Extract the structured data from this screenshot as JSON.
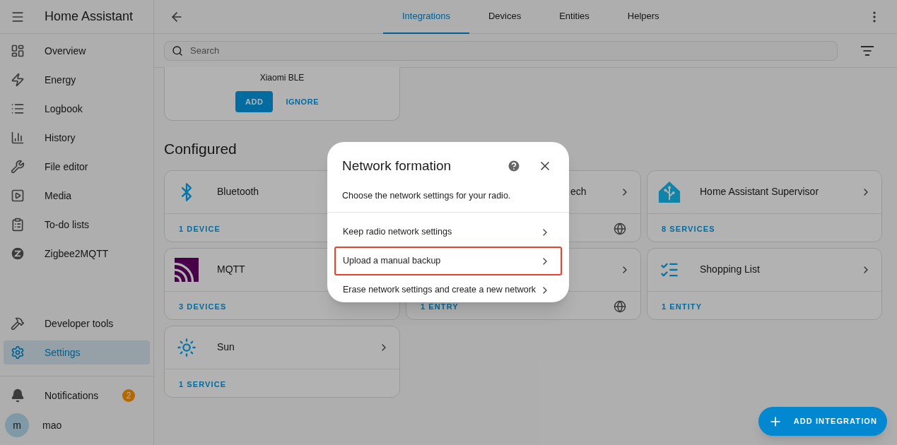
{
  "sidebar": {
    "title": "Home Assistant",
    "items": [
      {
        "label": "Overview",
        "selected": false
      },
      {
        "label": "Energy",
        "selected": false
      },
      {
        "label": "Logbook",
        "selected": false
      },
      {
        "label": "History",
        "selected": false
      },
      {
        "label": "File editor",
        "selected": false
      },
      {
        "label": "Media",
        "selected": false
      },
      {
        "label": "To-do lists",
        "selected": false
      },
      {
        "label": "Zigbee2MQTT",
        "selected": false
      }
    ],
    "bottom_items": [
      {
        "label": "Developer tools",
        "selected": false
      },
      {
        "label": "Settings",
        "selected": true
      }
    ],
    "notifications": {
      "label": "Notifications",
      "badge": "2"
    },
    "user": {
      "initial": "m",
      "name": "mao"
    }
  },
  "tabs": [
    {
      "label": "Integrations",
      "selected": true
    },
    {
      "label": "Devices",
      "selected": false
    },
    {
      "label": "Entities",
      "selected": false
    },
    {
      "label": "Helpers",
      "selected": false
    }
  ],
  "search": {
    "placeholder": "Search"
  },
  "discovered": {
    "name": "Xiaomi BLE",
    "buttons": [
      "ADD",
      "IGNORE"
    ]
  },
  "section_title": "Configured",
  "cards": [
    {
      "name": "Bluetooth",
      "footer": "1 DEVICE"
    },
    {
      "name": "ech",
      "cloud": true,
      "chevron": true
    },
    {
      "name": "Home Assistant Supervisor",
      "footer": "8 SERVICES",
      "cloud": false,
      "chevron": true
    },
    {
      "name": "MQTT",
      "footer": "3 DEVICES"
    },
    {
      "footer": "1 ENTRY",
      "cloud": true,
      "chevron": true
    },
    {
      "name": "Shopping List",
      "footer": "1 ENTITY",
      "cloud": false,
      "chevron": true
    },
    {
      "name": "Sun",
      "footer": "1 SERVICE",
      "cloud": false,
      "chevron": true
    }
  ],
  "fab": {
    "label": "ADD INTEGRATION"
  },
  "dialog": {
    "title": "Network formation",
    "subtitle": "Choose the network settings for your radio.",
    "options": [
      {
        "label": "Keep radio network settings",
        "highlighted": false
      },
      {
        "label": "Upload a manual backup",
        "highlighted": true
      },
      {
        "label": "Erase network settings and create a new network",
        "highlighted": false
      }
    ]
  }
}
